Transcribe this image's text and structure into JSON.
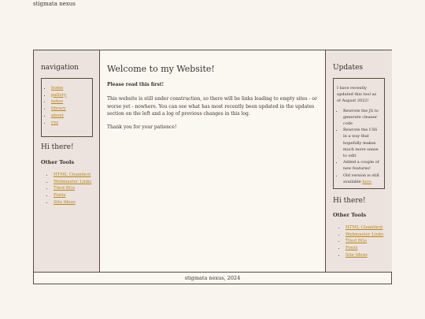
{
  "site_title": "stigmata nexus",
  "nav": {
    "heading": "navigation",
    "links": [
      "home",
      "gallery",
      "notes",
      "library",
      "about",
      "cvs"
    ]
  },
  "left_hi": "Hi there!",
  "left_tools": {
    "heading": "Other Tools",
    "links": [
      "HTML Cleanliest",
      "Webmaster Links",
      "Tiled BGs",
      "Fonts",
      "Site Ideas"
    ]
  },
  "main": {
    "title": "Welcome to my Website!",
    "read_first": "Please read this first!",
    "para": "This website is still under construction, so there will be links leading to empty sites - or worse yet - nowhere. You can see what has most recently been updated in the updates section on the left and a log of previous changes in this log.",
    "thanks": "Thank you for your patience!"
  },
  "updates": {
    "heading": "Updates",
    "intro": "I have recently updated this tool as of August 2022!",
    "items": [
      "Rewrote the JS to generate cleaner code",
      "Rewrote the CSS in a way that hopefully makes much more sense to edit",
      "Added a couple of new features!"
    ],
    "old_prefix": "Old version is still available",
    "old_link": "here"
  },
  "right_hi": "Hi there!",
  "right_tools": {
    "heading": "Other Tools",
    "links": [
      "HTML Cleanliest",
      "Webmaster Links",
      "Tiled BGs",
      "Fonts",
      "Site Ideas"
    ]
  },
  "footer": "stigmata nexus, 2024",
  "colors": {
    "accent_link": "#b88518",
    "border": "#5a4a3f",
    "panel": "#ece3de"
  }
}
